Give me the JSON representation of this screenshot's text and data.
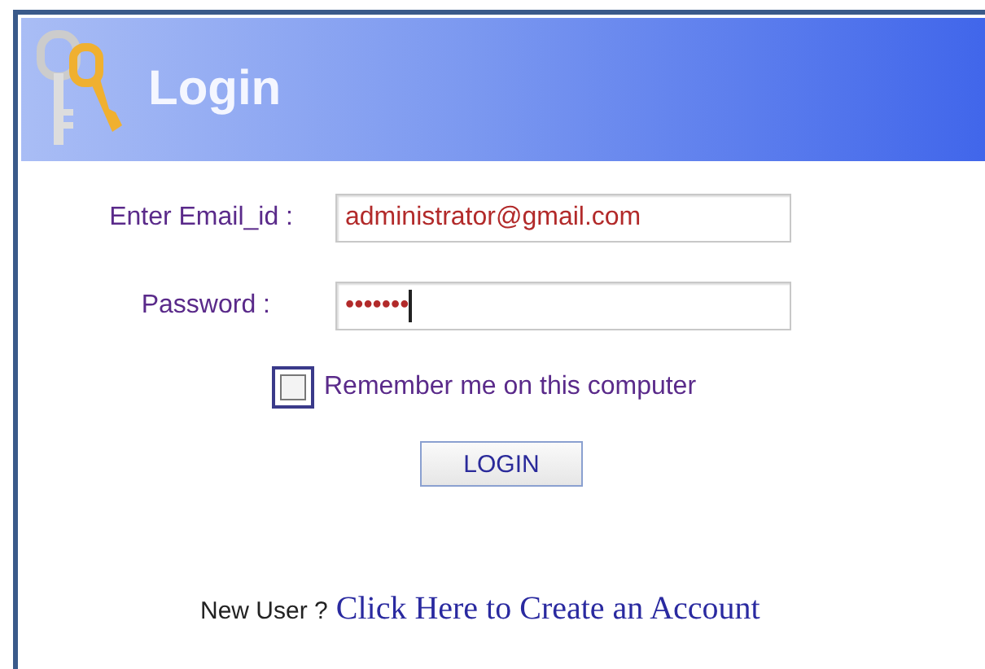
{
  "header": {
    "title": "Login"
  },
  "form": {
    "fields": [
      {
        "label": "Enter Email_id :",
        "value": "administrator@gmail.com",
        "kind": "text"
      },
      {
        "label": "Password :",
        "value": "•••••••",
        "kind": "password"
      }
    ],
    "remember": {
      "label": "Remember me on this computer",
      "checked": false
    },
    "button": "LOGIN"
  },
  "footer": {
    "prompt": "New User ?",
    "link": "Click Here to Create an Account"
  }
}
